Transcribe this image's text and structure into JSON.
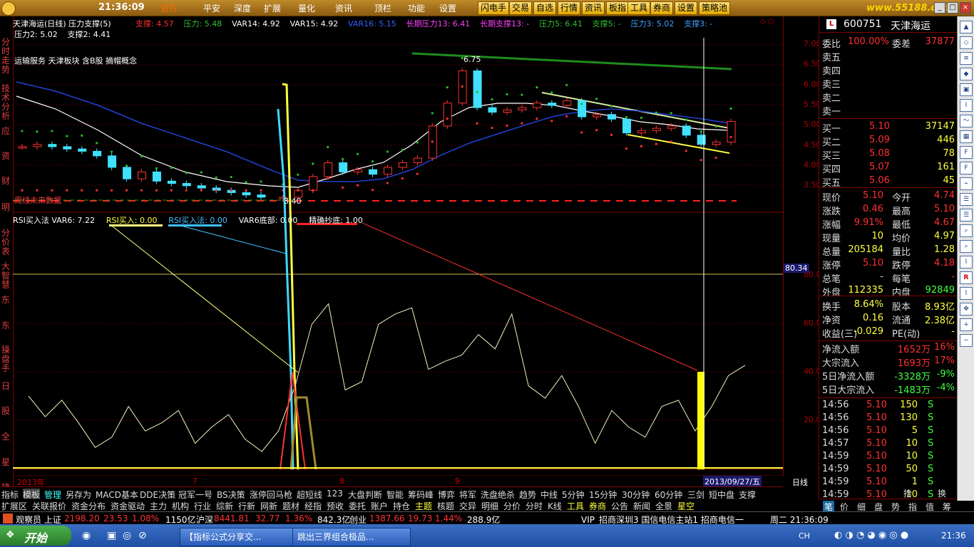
{
  "topbar": {
    "time": "21:36:09",
    "menu": [
      "官方",
      "平安",
      "深度",
      "扩展",
      "量化",
      "资讯",
      "顶栏",
      "功能",
      "设置"
    ],
    "buttons": [
      "闪电手",
      "交易",
      "自选",
      "行情",
      "资讯",
      "板指",
      "工具",
      "券商",
      "设置",
      "策略池"
    ],
    "watermark": "www.55188.com"
  },
  "left_tabs": [
    "分时走势",
    "技术分析",
    "应",
    "资",
    "财",
    "明",
    "分价表",
    "大智慧",
    "东",
    "东",
    "操盘手",
    "日",
    "股",
    "全",
    "星",
    "持"
  ],
  "chart": {
    "title": "天津海运(日线) 压力支撑(5)",
    "indicators_line1": [
      {
        "label": "支撑: 4.57",
        "color": "#ff3030"
      },
      {
        "label": "压力: 5.48",
        "color": "#30c030"
      },
      {
        "label": "VAR14: 4.92",
        "color": "#ffffff"
      },
      {
        "label": "VAR15: 4.92",
        "color": "#ffffff"
      },
      {
        "label": "VAR16: 5.15",
        "color": "#3060ff"
      },
      {
        "label": "长期压力13: 6.41",
        "color": "#ff40ff"
      },
      {
        "label": "长期支撑13: -",
        "color": "#ff40ff"
      },
      {
        "label": "压力5: 6.41",
        "color": "#30c030"
      },
      {
        "label": "支撑5: -",
        "color": "#30c030"
      },
      {
        "label": "压力3: 5.02",
        "color": "#40a0ff"
      },
      {
        "label": "支撑3: -",
        "color": "#40a0ff"
      }
    ],
    "indicators_line2": [
      {
        "label": "压力2: 5.02",
        "color": "#ffffff"
      },
      {
        "label": "支撑2: 4.41",
        "color": "#ffffff"
      }
    ],
    "concept": "运输服务 天津板块 含B股 摘帽概念",
    "marker_low": "3.40",
    "marker_high": "6.75",
    "week_label": "周线未来数据",
    "lower_indicators": [
      {
        "label": "RSI买入法 VAR6: 7.22",
        "color": "#ffffff"
      },
      {
        "label": "RSI买入: 0.00",
        "color": "#ffff40"
      },
      {
        "label": "RSI买入法: 0.00",
        "color": "#40c0ff"
      },
      {
        "label": "VAR6底部: 0.00",
        "color": "#ffffff"
      },
      {
        "label": "精确抄底: 1.00",
        "color": "#ffffff"
      }
    ],
    "x_labels": [
      "2013年",
      "7",
      "8",
      "9"
    ],
    "date_tag": "2013/09/27/五",
    "period": "日线"
  },
  "price_axis": [
    "7.00",
    "6.50",
    "6.00",
    "5.50",
    "5.00",
    "4.50",
    "4.00",
    "3.50"
  ],
  "rsi_axis": [
    "80.00",
    "60.00",
    "40.00",
    "20.00"
  ],
  "rsi_cursor": "80.34",
  "chart_data": {
    "type": "candlestick",
    "ylim": [
      3.2,
      7.2
    ],
    "close_series_y": [
      4.55,
      4.6,
      4.55,
      4.5,
      4.45,
      4.35,
      4.1,
      3.85,
      4.0,
      3.8,
      3.75,
      3.7,
      3.65,
      3.6,
      3.55,
      3.5,
      3.45,
      3.45,
      3.6,
      3.9,
      4.2,
      4.0,
      4.05,
      3.95,
      4.1,
      4.2,
      4.3,
      5.0,
      5.5,
      6.2,
      5.4,
      5.3,
      5.35,
      5.4,
      5.5,
      5.45,
      5.55,
      5.2,
      5.25,
      5.15,
      4.85,
      4.9,
      4.95,
      5.0,
      4.8,
      4.6,
      4.65,
      5.1
    ],
    "rsi_values": [
      35,
      25,
      33,
      22,
      10,
      15,
      30,
      18,
      22,
      28,
      12,
      20,
      26,
      14,
      8,
      18,
      40,
      70,
      80,
      38,
      42,
      70,
      75,
      78,
      48,
      52,
      55,
      65,
      58,
      75,
      40,
      34,
      45,
      30,
      12,
      28,
      20,
      15,
      30,
      33,
      18,
      30,
      45,
      50
    ]
  },
  "quote": {
    "code": "600751",
    "name": "天津海运",
    "weibi_label": "委比",
    "weibi": "100.00%",
    "weicha_label": "委差",
    "weicha": "37877",
    "sell": [
      {
        "label": "卖五",
        "price": "",
        "vol": ""
      },
      {
        "label": "卖四",
        "price": "",
        "vol": ""
      },
      {
        "label": "卖三",
        "price": "",
        "vol": ""
      },
      {
        "label": "卖二",
        "price": "",
        "vol": ""
      },
      {
        "label": "卖一",
        "price": "",
        "vol": ""
      }
    ],
    "buy": [
      {
        "label": "买一",
        "price": "5.10",
        "vol": "37147"
      },
      {
        "label": "买二",
        "price": "5.09",
        "vol": "446"
      },
      {
        "label": "买三",
        "price": "5.08",
        "vol": "78"
      },
      {
        "label": "买四",
        "price": "5.07",
        "vol": "161"
      },
      {
        "label": "买五",
        "price": "5.06",
        "vol": "45"
      }
    ],
    "stats": [
      [
        "现价",
        "5.10",
        "今开",
        "4.74"
      ],
      [
        "涨跌",
        "0.46",
        "最高",
        "5.10"
      ],
      [
        "涨幅",
        "9.91%",
        "最低",
        "4.67"
      ],
      [
        "现量",
        "10",
        "均价",
        "4.97"
      ],
      [
        "总量",
        "205184",
        "量比",
        "1.28"
      ],
      [
        "涨停",
        "5.10",
        "跌停",
        "4.18"
      ],
      [
        "总笔",
        "-",
        "每笔",
        "-"
      ],
      [
        "外盘",
        "112335",
        "内盘",
        "92849"
      ]
    ],
    "stats2": [
      [
        "换手",
        "8.64%",
        "股本",
        "8.93亿"
      ],
      [
        "净资",
        "0.16",
        "流通",
        "2.38亿"
      ],
      [
        "收益(三)",
        "-0.029",
        "PE(动)",
        "-"
      ]
    ],
    "flows": [
      [
        "净流入额",
        "1652万",
        "16%"
      ],
      [
        "大宗流入",
        "1693万",
        "17%"
      ],
      [
        "5日净流入额",
        "-3328万",
        "-9%"
      ],
      [
        "5日大宗流入",
        "-1483万",
        "-4%"
      ]
    ],
    "ticks": [
      [
        "14:56",
        "5.10",
        "150",
        "S"
      ],
      [
        "14:56",
        "5.10",
        "130",
        "S"
      ],
      [
        "14:56",
        "5.10",
        "5",
        "S"
      ],
      [
        "14:57",
        "5.10",
        "10",
        "S"
      ],
      [
        "14:59",
        "5.10",
        "10",
        "S"
      ],
      [
        "14:59",
        "5.10",
        "50",
        "S"
      ],
      [
        "14:59",
        "5.10",
        "1",
        "S"
      ],
      [
        "14:59",
        "5.10",
        "10",
        "S"
      ]
    ],
    "bottom_tabs": [
      "笔",
      "价",
      "细",
      "盘",
      "势",
      "指",
      "值",
      "筹"
    ],
    "mini": [
      "抬",
      "换"
    ]
  },
  "bottom_row1": [
    "指标",
    "模板",
    "管理",
    "另存为",
    "MACD基本",
    "DDE决策",
    "冠军一号",
    "BS决策",
    "涨停回马枪",
    "超短线",
    "123",
    "大盘判断",
    "智能",
    "筹码峰",
    "博弈",
    "将军",
    "洗盘绝杀",
    "趋势",
    "中线",
    "5分钟",
    "15分钟",
    "30分钟",
    "60分钟",
    "三剑",
    "短中盘",
    "支撑"
  ],
  "bottom_row2": [
    "扩展区",
    "关联报价",
    "资金分布",
    "资金驱动",
    "主力",
    "机构",
    "行业",
    "综新",
    "行新",
    "网新",
    "题材",
    "经指",
    "预收",
    "委托",
    "账户",
    "持仓",
    "主题",
    "核题",
    "交异",
    "明细",
    "分价",
    "分时",
    "K线",
    "工具",
    "券商",
    "公告",
    "新闻",
    "全景",
    "星空"
  ],
  "statusbar": {
    "left": "观察员 上证",
    "sh": "2198.20",
    "sh_chg": "23.53",
    "sh_pct": "1.08%",
    "sh_amt": "1150亿",
    "sz_label": "沪深",
    "sz": "8441.81",
    "sz_chg": "32.77",
    "sz_pct": "1.36%",
    "sz_amt": "842.3亿",
    "cy_label": "创业",
    "cy": "1387.66",
    "cy_chg": "19.73",
    "cy_pct": "1.44%",
    "cy_amt": "288.9亿",
    "server": "VIP_招商深圳3 国信电信主站1 招商电信一",
    "clock": "周二 21:36:09"
  },
  "taskbar": {
    "start": "开始",
    "tasks": [
      "【指标公式分享交...",
      "跳出三界组合极品..."
    ],
    "lang": "CH",
    "time": "21:36"
  }
}
